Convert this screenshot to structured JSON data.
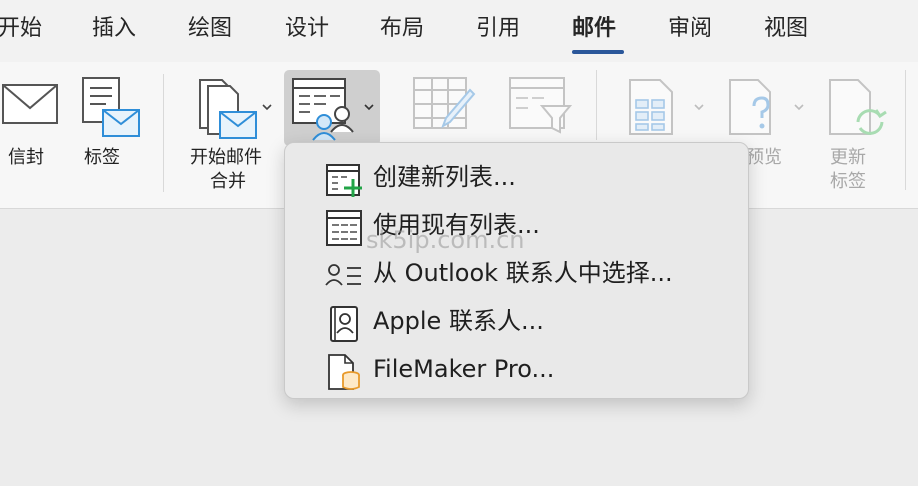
{
  "tabs": [
    {
      "label": "开始"
    },
    {
      "label": "插入"
    },
    {
      "label": "绘图"
    },
    {
      "label": "设计"
    },
    {
      "label": "布局"
    },
    {
      "label": "引用"
    },
    {
      "label": "邮件"
    },
    {
      "label": "审阅"
    },
    {
      "label": "视图"
    }
  ],
  "ribbon": {
    "envelope_label": "信封",
    "labels_label": "标签",
    "start_merge_line1": "开始邮件",
    "start_merge_line2": "合并",
    "preview_label_partial": "预览",
    "update_labels_line1": "更新",
    "update_labels_line2": "标签"
  },
  "menu": {
    "items": [
      {
        "label": "创建新列表..."
      },
      {
        "label": "使用现有列表..."
      },
      {
        "label": "从 Outlook 联系人中选择..."
      },
      {
        "label": "Apple 联系人..."
      },
      {
        "label": "FileMaker Pro..."
      }
    ]
  },
  "watermark": "sk5ip.com.cn"
}
